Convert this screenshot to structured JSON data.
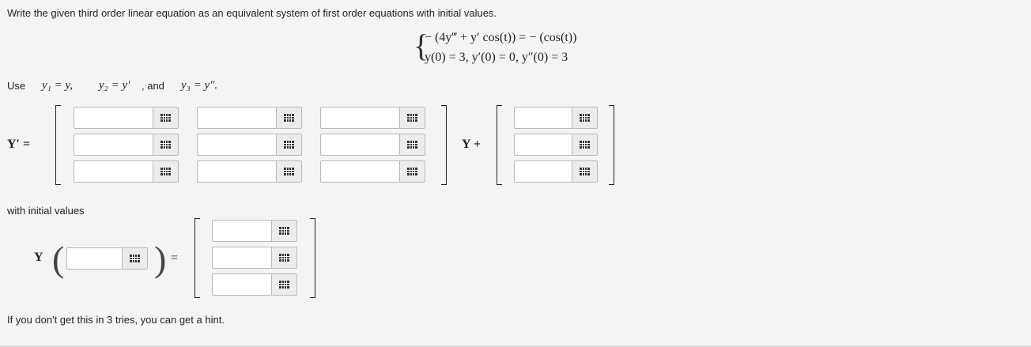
{
  "prompt": "Write the given third order linear equation as an equivalent system of first order equations with initial values.",
  "equation": {
    "line1": "− (4y‴ + y′ cos(t)) = − (cos(t))",
    "line2": "y(0) = 3,   y′(0) = 0,   y″(0) = 3"
  },
  "use_line": {
    "use": "Use",
    "y1": "y₁ = y,",
    "y2": "y₂ = y′",
    "and": ", and",
    "y3": "y₃ = y″."
  },
  "system": {
    "lhs": "Y′ =",
    "times": "Y +",
    "matrix_icon": "grid-icon",
    "vector_icon": "grid-icon"
  },
  "initial": {
    "label": "with initial values",
    "lhs": "Y",
    "equals": "=",
    "icon": "grid-icon"
  },
  "hint": "If you don't get this in 3 tries, you can get a hint."
}
